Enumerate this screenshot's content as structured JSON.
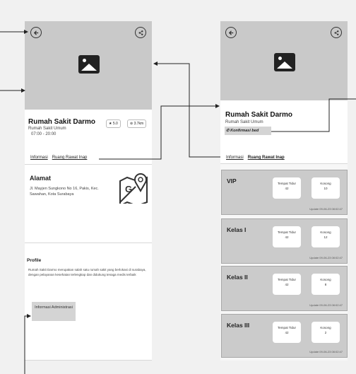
{
  "left_screen": {
    "hospital_name": "Rumah Sakit Darmo",
    "hospital_type": "Rumah Sakit Umum",
    "hours": "07:00 - 20:00",
    "rating": "★ 5.0",
    "distance": "⊚ 3.7km",
    "tabs": [
      "Informasi",
      "Ruang Rawat Inap"
    ],
    "address_title": "Alamat",
    "address_text": "Jl. Mayjen Sungkono No 16, Pakis, Kec. Sawahan, Kota Surabaya",
    "profile_title": "Profile",
    "profile_text": "Rumah Sakit Darmo merupakan salah satu rumah sakit yang berlokasi di surabaya, dengan pelayanan kesehatan terlengkap dan didukung tenaga medis terbaik",
    "admin_button": "Informasi Administrasi"
  },
  "right_screen": {
    "hospital_name": "Rumah Sakit Darmo",
    "hospital_type": "Rumah Sakit Umum",
    "confirm_label": "Konfirmasi bed",
    "tabs": [
      "Informasi",
      "Ruang Rawat Inap"
    ],
    "classes": [
      {
        "name": "VIP",
        "total_label": "Tempat Tidur",
        "total": "42",
        "empty_label": "Kosong",
        "empty": "10",
        "update": "Update 09-06-23 08:02:47"
      },
      {
        "name": "Kelas I",
        "total_label": "Tempat Tidur",
        "total": "42",
        "empty_label": "Kosong",
        "empty": "12",
        "update": "Update 09-06-23 08:02:47"
      },
      {
        "name": "Kelas II",
        "total_label": "Tempat Tidur",
        "total": "42",
        "empty_label": "Kosong",
        "empty": "8",
        "update": "Update 09-06-23 08:02:47"
      },
      {
        "name": "Kelas III",
        "total_label": "Tempat Tidur",
        "total": "42",
        "empty_label": "Kosong",
        "empty": "2",
        "update": "Update 09-06-23 08:02:47"
      }
    ]
  },
  "colors": {
    "background": "#f1f1f1",
    "hero": "#c9c9c9",
    "card_grey": "#cbcbcb",
    "line": "#222222"
  },
  "icons": [
    "back-arrow-icon",
    "share-icon",
    "image-placeholder-icon",
    "map-icon",
    "phone-icon"
  ]
}
